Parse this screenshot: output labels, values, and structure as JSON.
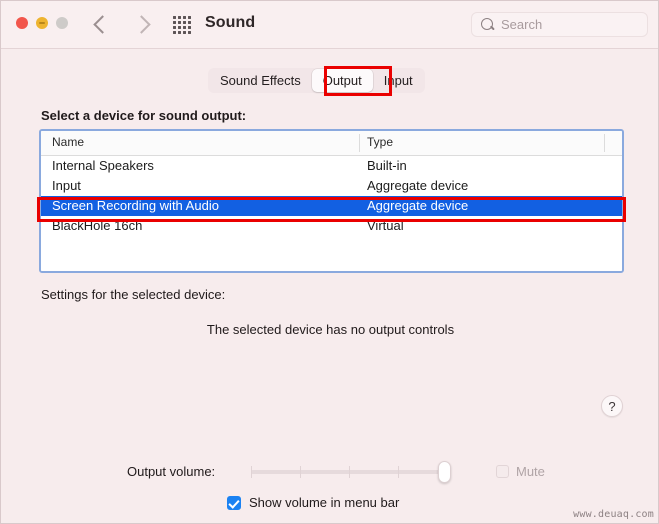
{
  "window": {
    "title": "Sound",
    "traffic_lights": [
      "close",
      "minimize",
      "zoom"
    ]
  },
  "toolbar": {
    "back_label": "Back",
    "forward_label": "Forward",
    "show_all_label": "Show All",
    "search": {
      "placeholder": "Search",
      "value": ""
    }
  },
  "tabs": [
    {
      "label": "Sound Effects",
      "selected": false
    },
    {
      "label": "Output",
      "selected": true
    },
    {
      "label": "Input",
      "selected": false
    }
  ],
  "annotations": {
    "tab_box_color": "#ea0000",
    "row_box_color": "#ea0000"
  },
  "device_section": {
    "label": "Select a device for sound output:",
    "columns": [
      "Name",
      "Type"
    ],
    "rows": [
      {
        "name": "Internal Speakers",
        "type": "Built-in",
        "selected": false
      },
      {
        "name": "Input",
        "type": "Aggregate device",
        "selected": false
      },
      {
        "name": "Screen Recording with Audio",
        "type": "Aggregate device",
        "selected": true
      },
      {
        "name": "BlackHole 16ch",
        "type": "Virtual",
        "selected": false
      }
    ],
    "selection_color": "#1260e2",
    "focus_ring_color": "#8aa9de"
  },
  "settings_section": {
    "label": "Settings for the selected device:",
    "message": "The selected device has no output controls"
  },
  "help": {
    "label": "?"
  },
  "bottom_controls": {
    "output_volume_label": "Output volume:",
    "volume_percent": 95,
    "speaker_low_icon": "speaker-muted-icon",
    "speaker_high_icon": "speaker-waves-icon",
    "mute": {
      "label": "Mute",
      "checked": false,
      "disabled": true
    },
    "show_volume_in_menu_bar": {
      "label": "Show volume in menu bar",
      "checked": true
    }
  },
  "watermark": "www.deuaq.com"
}
